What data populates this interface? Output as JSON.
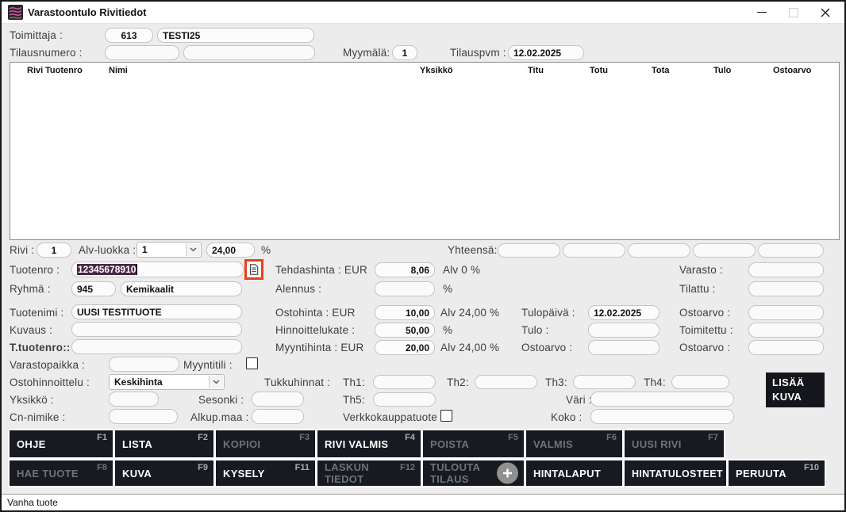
{
  "colors": {
    "selection_purple": "#4b2747",
    "focus_highlight_orange": "#e8401c",
    "button_dark": "#171a21",
    "logo_pink": "#d8579e"
  },
  "titlebar": {
    "title": "Varastoontulo Rivitiedot"
  },
  "header": {
    "toimittaja_label": "Toimittaja :",
    "toimittaja_code": "613",
    "toimittaja_name": "TESTI25",
    "tilausnumero_label": "Tilausnumero :",
    "myymala_label": "Myymälä:",
    "myymala_value": "1",
    "tilauspvm_label": "Tilauspvm :",
    "tilauspvm_value": "12.02.2025"
  },
  "grid": {
    "headers": [
      "Rivi",
      "Tuotenro",
      "Nimi",
      "Yksikkö",
      "Titu",
      "Totu",
      "Tota",
      "Tulo",
      "Ostoarvo"
    ]
  },
  "form": {
    "rivi_label": "Rivi :",
    "rivi_value": "1",
    "alv_luokka_label": "Alv-luokka :",
    "alv_luokka_value": "1",
    "alv_pct": "24,00",
    "pct": "%",
    "yhteensa_label": "Yhteensä:",
    "tuotenro_label": "Tuotenro :",
    "tuotenro_value": "12345678910",
    "tehdashinta_label": "Tehdashinta : EUR",
    "tehdashinta_value": "8,06",
    "tehdashinta_alv": "Alv 0 %",
    "varasto_label": "Varasto :",
    "ryhma_label": "Ryhmä :",
    "ryhma_code": "945",
    "ryhma_name": "Kemikaalit",
    "alennus_label": "Alennus :",
    "tilattu_label": "Tilattu :",
    "tuotenimi_label": "Tuotenimi :",
    "tuotenimi_value": "UUSI TESTITUOTE",
    "ostohinta_label": "Ostohinta : EUR",
    "ostohinta_value": "10,00",
    "ostohinta_alv": "Alv 24,00 %",
    "tulopaiva_label": "Tulopäivä :",
    "tulopaiva_value": "12.02.2025",
    "ostoarvo_label": "Ostoarvo :",
    "kuvaus_label": "Kuvaus :",
    "hinnoittelukate_label": "Hinnoittelukate :",
    "hinnoittelukate_value": "50,00",
    "tulo_label": "Tulo :",
    "toimitettu_label": "Toimitettu :",
    "t_tuotenro_label": "T.tuotenro::",
    "myyntihinta_label": "Myyntihinta : EUR",
    "myyntihinta_value": "20,00",
    "myyntihinta_alv": "Alv 24,00 %",
    "varastopaikka_label": "Varastopaikka :",
    "myyntitili_label": "Myyntitili :",
    "ostohinnoittelu_label": "Ostohinnoittelu :",
    "ostohinnoittelu_value": "Keskihinta",
    "tukkuhinnat_label": "Tukkuhinnat :",
    "th1": "Th1:",
    "th2": "Th2:",
    "th3": "Th3:",
    "th4": "Th4:",
    "th5": "Th5:",
    "yksikko_label": "Yksikkö :",
    "sesonki_label": "Sesonki :",
    "vari_label": "Väri :",
    "cn_nimike_label": "Cn-nimike :",
    "alkup_maa_label": "Alkup.maa :",
    "verkkokauppa_label": "Verkkokauppatuote :",
    "koko_label": "Koko :",
    "lisaa_kuva_label": "LISÄÄ KUVA"
  },
  "buttons": {
    "row1": [
      {
        "label": "OHJE",
        "fkey": "F1"
      },
      {
        "label": "LISTA",
        "fkey": "F2"
      },
      {
        "label": "KOPIOI",
        "fkey": "F3"
      },
      {
        "label": "RIVI VALMIS",
        "fkey": "F4"
      },
      {
        "label": "POISTA",
        "fkey": "F5"
      },
      {
        "label": "VALMIS",
        "fkey": "F6"
      },
      {
        "label": "UUSI RIVI",
        "fkey": "F7"
      }
    ],
    "row2": [
      {
        "label": "HAE TUOTE",
        "fkey": "F8"
      },
      {
        "label": "KUVA",
        "fkey": "F9"
      },
      {
        "label": "KYSELY",
        "fkey": "F11"
      },
      {
        "label": "LASKUN TIEDOT",
        "fkey": "F12"
      },
      {
        "label": "TULOUTA TILAUS",
        "fkey": ""
      },
      {
        "label": "HINTALAPUT",
        "fkey": ""
      },
      {
        "label": "HINTATULOSTEET",
        "fkey": ""
      },
      {
        "label": "PERUUTA",
        "fkey": "F10"
      }
    ]
  },
  "statusbar": {
    "text": "Vanha tuote"
  }
}
